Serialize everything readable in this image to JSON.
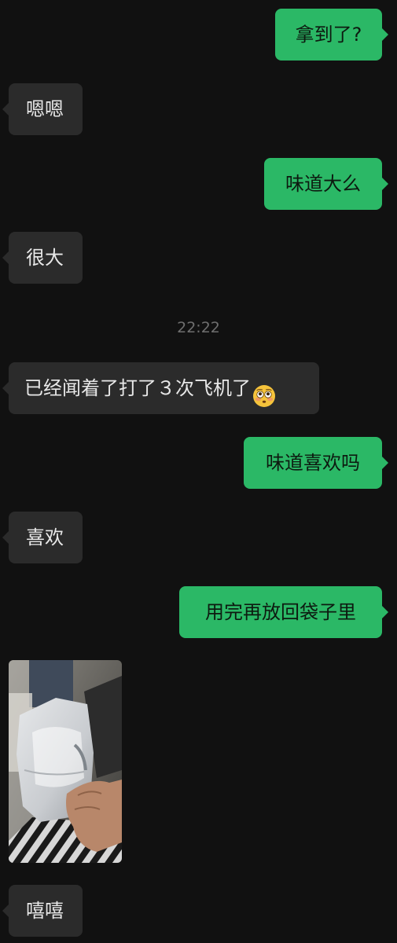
{
  "messages": [
    {
      "id": "m1",
      "direction": "outgoing",
      "text": "拿到了?"
    },
    {
      "id": "m2",
      "direction": "incoming",
      "text": "嗯嗯"
    },
    {
      "id": "m3",
      "direction": "outgoing",
      "text": "味道大么"
    },
    {
      "id": "m4",
      "direction": "incoming",
      "text": "很大"
    },
    {
      "id": "m5",
      "direction": "incoming",
      "text": "已经闻着了打了３次飞机了",
      "emoji": "flushed-face-icon"
    },
    {
      "id": "m6",
      "direction": "outgoing",
      "text": "味道喜欢吗"
    },
    {
      "id": "m7",
      "direction": "incoming",
      "text": "喜欢"
    },
    {
      "id": "m8",
      "direction": "outgoing",
      "text": "用完再放回袋子里"
    },
    {
      "id": "m9",
      "direction": "incoming",
      "type": "image",
      "image": "photo-of-socks-in-plastic-bag"
    },
    {
      "id": "m10",
      "direction": "incoming",
      "text": "嘻嘻"
    }
  ],
  "timestamp": "22:22",
  "colors": {
    "background": "#111111",
    "outgoing_bubble": "#2bb866",
    "incoming_bubble": "#2b2b2b",
    "timestamp_text": "#6f6f6f"
  }
}
